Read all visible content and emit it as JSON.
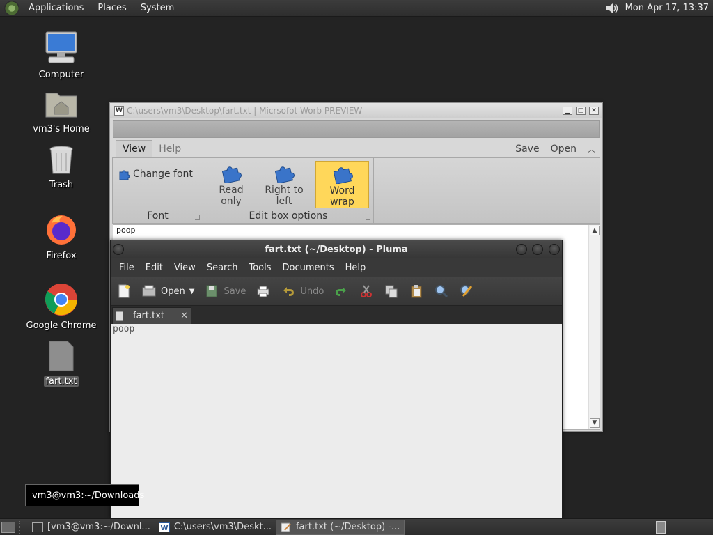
{
  "top_panel": {
    "menus": [
      "Applications",
      "Places",
      "System"
    ],
    "clock": "Mon Apr 17, 13:37"
  },
  "desktop": {
    "icons": [
      {
        "label": "Computer"
      },
      {
        "label": "vm3's Home"
      },
      {
        "label": "Trash"
      },
      {
        "label": "Firefox"
      },
      {
        "label": "Google Chrome"
      },
      {
        "label": "fart.txt"
      }
    ]
  },
  "word_window": {
    "title": "C:\\users\\vm3\\Desktop\\fart.txt | Micrsofot Worb PREVIEW",
    "app_icon_letter": "W",
    "tabs": [
      "View",
      "Help"
    ],
    "right_actions": [
      "Save",
      "Open"
    ],
    "groups": {
      "font": {
        "name": "Font",
        "change_font": "Change font"
      },
      "options": {
        "name": "Edit box options",
        "buttons": [
          "Read only",
          "Right to left",
          "Word wrap"
        ]
      }
    },
    "document_text": "poop"
  },
  "pluma_window": {
    "title": "fart.txt (~/Desktop) - Pluma",
    "menu": [
      "File",
      "Edit",
      "View",
      "Search",
      "Tools",
      "Documents",
      "Help"
    ],
    "toolbar": {
      "open_label": "Open",
      "save_label": "Save",
      "undo_label": "Undo"
    },
    "tab_label": "fart.txt",
    "document_text": "poop"
  },
  "tooltip": "vm3@vm3:~/Downloads",
  "taskbar": {
    "tasks": [
      {
        "label": "[vm3@vm3:~/Downl..."
      },
      {
        "label": "C:\\users\\vm3\\Deskt..."
      },
      {
        "label": "fart.txt (~/Desktop) -..."
      }
    ]
  },
  "colors": {
    "desktop_bg": "#232323",
    "active_ribbon_button": "#ffd75a"
  }
}
